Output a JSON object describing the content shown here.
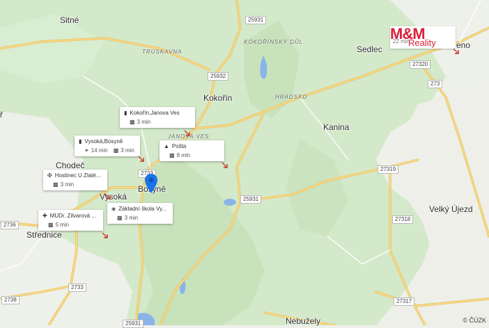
{
  "colors": {
    "land": "#eef0ea",
    "forest": "#cfe6c5",
    "forest_dark": "#c2dfb7",
    "road": "#f7d98a",
    "road_edge": "#e9bf57",
    "water": "#8ab4e8",
    "marker": "#1a73e8",
    "brand": "#d8203a"
  },
  "towns": [
    {
      "name": "Sitné"
    },
    {
      "name": "Sedlec"
    },
    {
      "name": "Kokořín"
    },
    {
      "name": "Kanina"
    },
    {
      "name": "Chodeč"
    },
    {
      "name": "Vysoká"
    },
    {
      "name": "Bosyně"
    },
    {
      "name": "Střednice"
    },
    {
      "name": "Velký Újezd"
    },
    {
      "name": "Nebužely"
    },
    {
      "name": "eno"
    },
    {
      "name": "ř"
    }
  ],
  "localities": [
    {
      "name": "TRUSKAVNA"
    },
    {
      "name": "KOKOŘÍNSKÝ DŮL"
    },
    {
      "name": "HRADSKO"
    },
    {
      "name": "JANOVA VES"
    }
  ],
  "road_numbers": [
    {
      "label": "25931"
    },
    {
      "label": "25932"
    },
    {
      "label": "27320"
    },
    {
      "label": "273"
    },
    {
      "label": "2733"
    },
    {
      "label": "25931"
    },
    {
      "label": "27319"
    },
    {
      "label": "27318"
    },
    {
      "label": "2736"
    },
    {
      "label": "2733"
    },
    {
      "label": "2738"
    },
    {
      "label": "27317"
    },
    {
      "label": "25931"
    }
  ],
  "pois": [
    {
      "name": "Kokořín,Janova Ves",
      "icon": "bus-icon",
      "times": [
        {
          "mode": "car-icon",
          "text": "3 min"
        }
      ]
    },
    {
      "name": "Vysoká,Bosyně",
      "icon": "bus-icon",
      "times": [
        {
          "mode": "walk-icon",
          "text": "14 min"
        },
        {
          "mode": "car-icon",
          "text": "3 min"
        }
      ]
    },
    {
      "name": "Pošta",
      "icon": "post-office-icon",
      "times": [
        {
          "mode": "car-icon",
          "text": "8 min"
        }
      ]
    },
    {
      "name": "Hostinec U Zlaté...",
      "icon": "restaurant-icon",
      "times": [
        {
          "mode": "car-icon",
          "text": "3 min"
        }
      ]
    },
    {
      "name": "Základní škola Vy...",
      "icon": "school-icon",
      "times": [
        {
          "mode": "car-icon",
          "text": "3 min"
        }
      ]
    },
    {
      "name": "MUDr. Zilvarová ...",
      "icon": "medical-icon",
      "times": [
        {
          "mode": "car-icon",
          "text": "5 min"
        }
      ]
    }
  ],
  "brand": {
    "logo": "M&M",
    "sub": "Reality",
    "time": "22 min"
  },
  "copyright": "© ČÚZK"
}
